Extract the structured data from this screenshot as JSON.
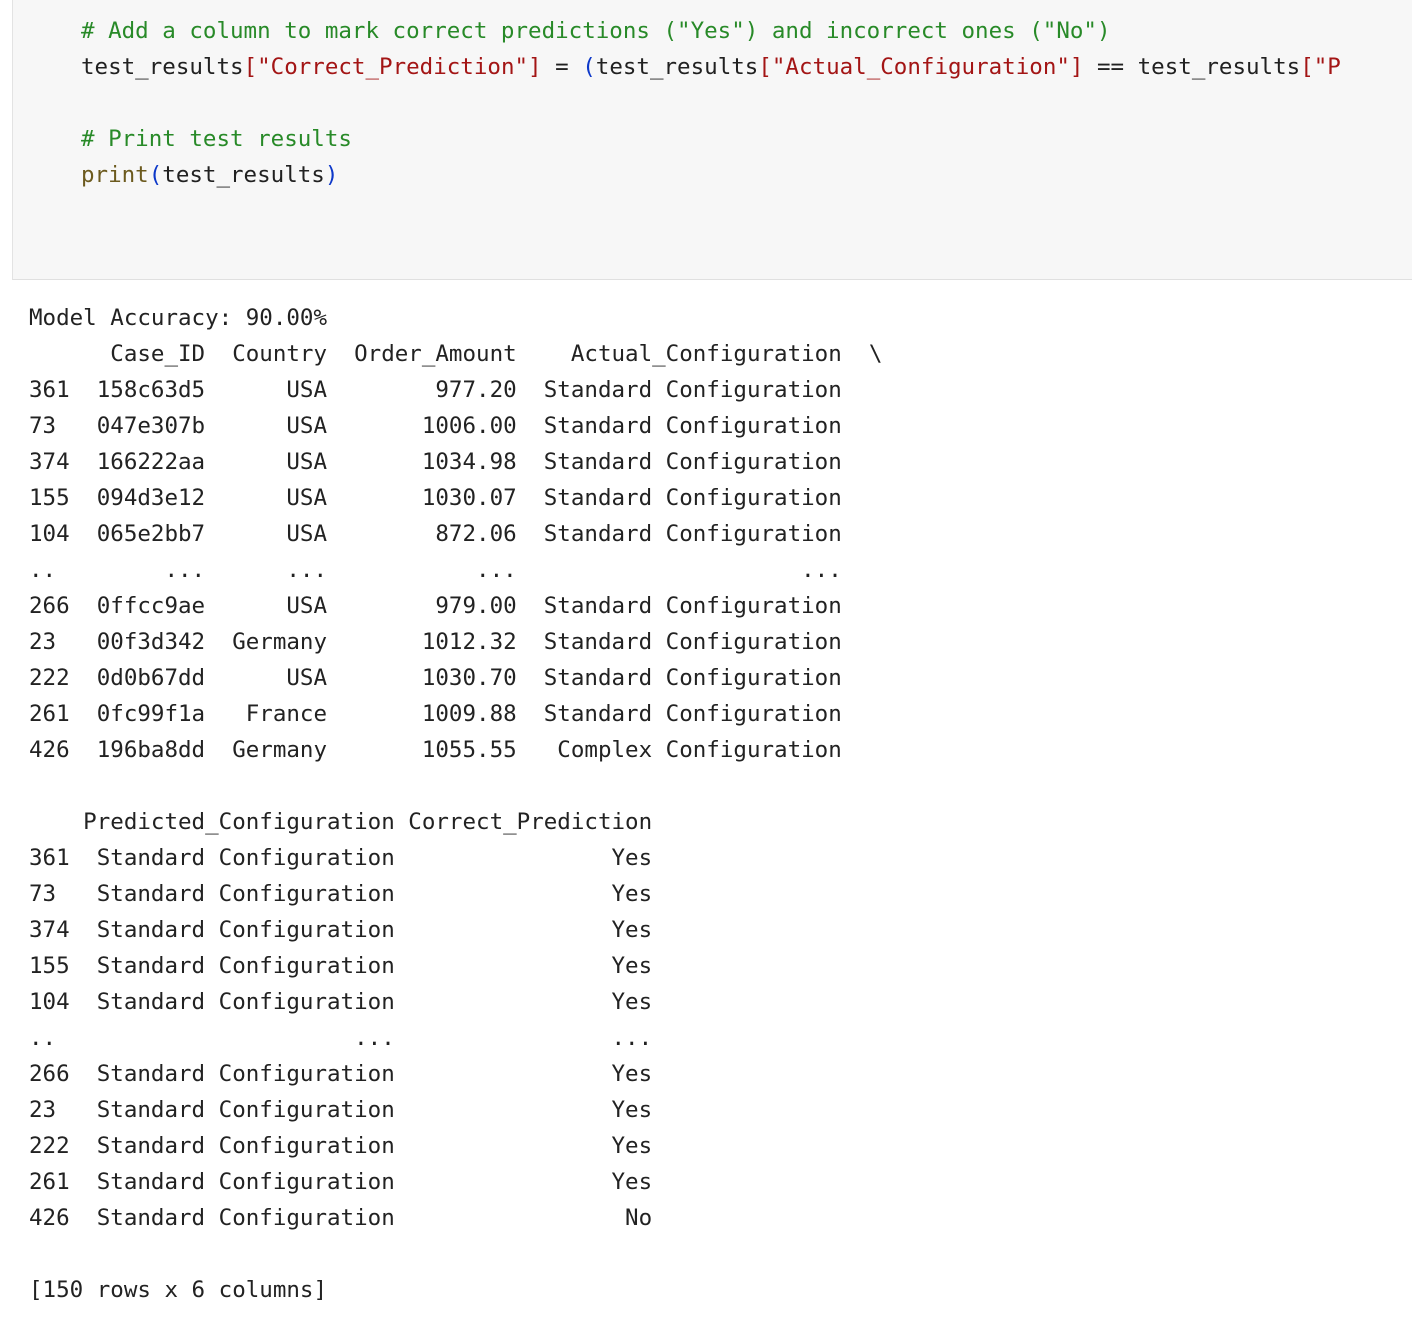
{
  "code_cell": {
    "comment_1": "# Add a column to mark correct predictions (\"Yes\") and incorrect ones (\"No\")",
    "line_2": {
      "var_1": "test_results",
      "bracket_open_1": "[",
      "key_1": "\"Correct_Prediction\"",
      "bracket_close_1": "]",
      "assign": " = ",
      "paren_open": "(",
      "var_2": "test_results",
      "bracket_open_2": "[",
      "key_2": "\"Actual_Configuration\"",
      "bracket_close_2": "]",
      "equals": " == ",
      "var_3": "test_results",
      "bracket_open_3": "[",
      "key_3_partial": "\"P"
    },
    "comment_2": "# Print test results",
    "line_5": {
      "func": "print",
      "paren_open": "(",
      "arg": "test_results",
      "paren_close": ")"
    }
  },
  "output": {
    "accuracy_line": "Model Accuracy: 90.00%",
    "table1_header": "      Case_ID  Country  Order_Amount    Actual_Configuration  \\",
    "table1_rows": [
      "361  158c63d5      USA        977.20  Standard Configuration",
      "73   047e307b      USA       1006.00  Standard Configuration",
      "374  166222aa      USA       1034.98  Standard Configuration",
      "155  094d3e12      USA       1030.07  Standard Configuration",
      "104  065e2bb7      USA        872.06  Standard Configuration",
      "..        ...      ...           ...                     ...",
      "266  0ffcc9ae      USA        979.00  Standard Configuration",
      "23   00f3d342  Germany       1012.32  Standard Configuration",
      "222  0d0b67dd      USA       1030.70  Standard Configuration",
      "261  0fc99f1a   France       1009.88  Standard Configuration",
      "426  196ba8dd  Germany       1055.55   Complex Configuration"
    ],
    "table2_header": "    Predicted_Configuration Correct_Prediction",
    "table2_rows": [
      "361  Standard Configuration                Yes",
      "73   Standard Configuration                Yes",
      "374  Standard Configuration                Yes",
      "155  Standard Configuration                Yes",
      "104  Standard Configuration                Yes",
      "..                      ...                ...",
      "266  Standard Configuration                Yes",
      "23   Standard Configuration                Yes",
      "222  Standard Configuration                Yes",
      "261  Standard Configuration                Yes",
      "426  Standard Configuration                 No"
    ],
    "summary": "[150 rows x 6 columns]"
  }
}
